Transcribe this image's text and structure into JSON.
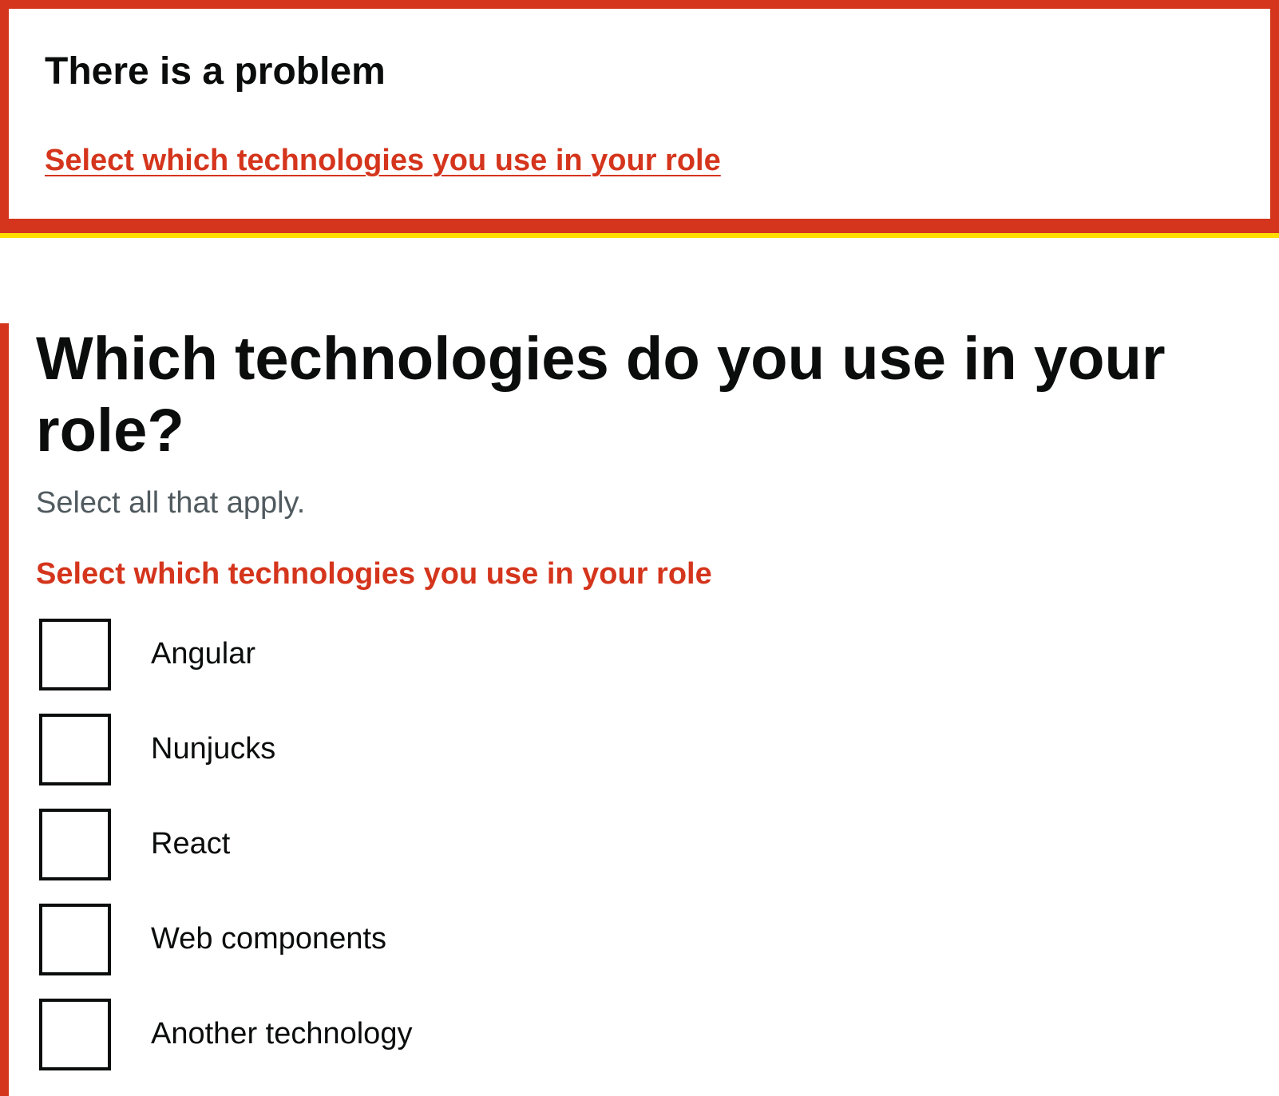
{
  "error_summary": {
    "title": "There is a problem",
    "link": "Select which technologies you use in your role"
  },
  "question": {
    "title": "Which technologies do you use in your role?",
    "hint": "Select all that apply.",
    "error": "Select which technologies you use in your role"
  },
  "options": [
    {
      "label": "Angular",
      "checked": false
    },
    {
      "label": "Nunjucks",
      "checked": false
    },
    {
      "label": "React",
      "checked": false
    },
    {
      "label": "Web components",
      "checked": false
    },
    {
      "label": "Another technology",
      "checked": false
    }
  ],
  "colors": {
    "error": "#d4351c",
    "focus": "#ffdd00",
    "text": "#0b0c0c",
    "hint": "#505a5f"
  }
}
